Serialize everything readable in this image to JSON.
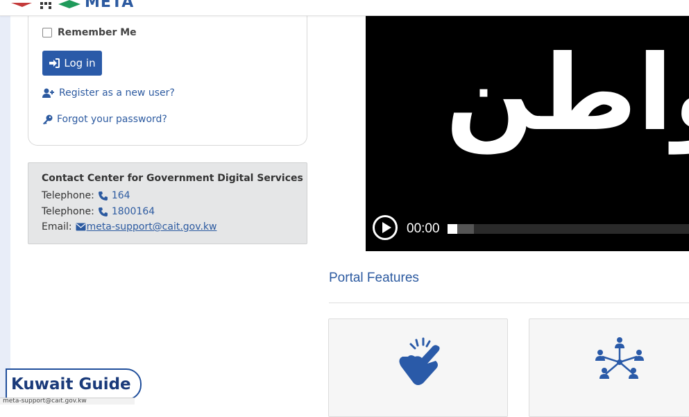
{
  "header": {
    "logo_text": "META"
  },
  "login": {
    "remember_label": "Remember Me",
    "login_button": "Log in",
    "register_link": "Register as a new user?",
    "forgot_link": "Forgot your password?"
  },
  "contact": {
    "title": "Contact Center for Government Digital Services",
    "phone_label_1": "Telephone:",
    "phone_1": "164",
    "phone_label_2": "Telephone:",
    "phone_2": "1800164",
    "email_label": "Email:",
    "email": " meta-support@cait.gov.kw"
  },
  "video": {
    "overlay_text": "واطن",
    "current_time": "00:00",
    "progress": 0.0
  },
  "features": {
    "title": "Portal Features"
  },
  "watermark": {
    "text": "Kuwait Guide"
  },
  "status_bar": {
    "url": "meta-support@cait.gov.kw"
  },
  "colors": {
    "primary": "#2a5aa8",
    "link": "#2c5aa0",
    "contact_bg": "#e5e6e7"
  },
  "icons": [
    "user-plus-icon",
    "key-icon",
    "sign-in-icon",
    "phone-icon",
    "envelope-icon",
    "snap-hand-icon",
    "network-people-icon",
    "play-icon"
  ]
}
